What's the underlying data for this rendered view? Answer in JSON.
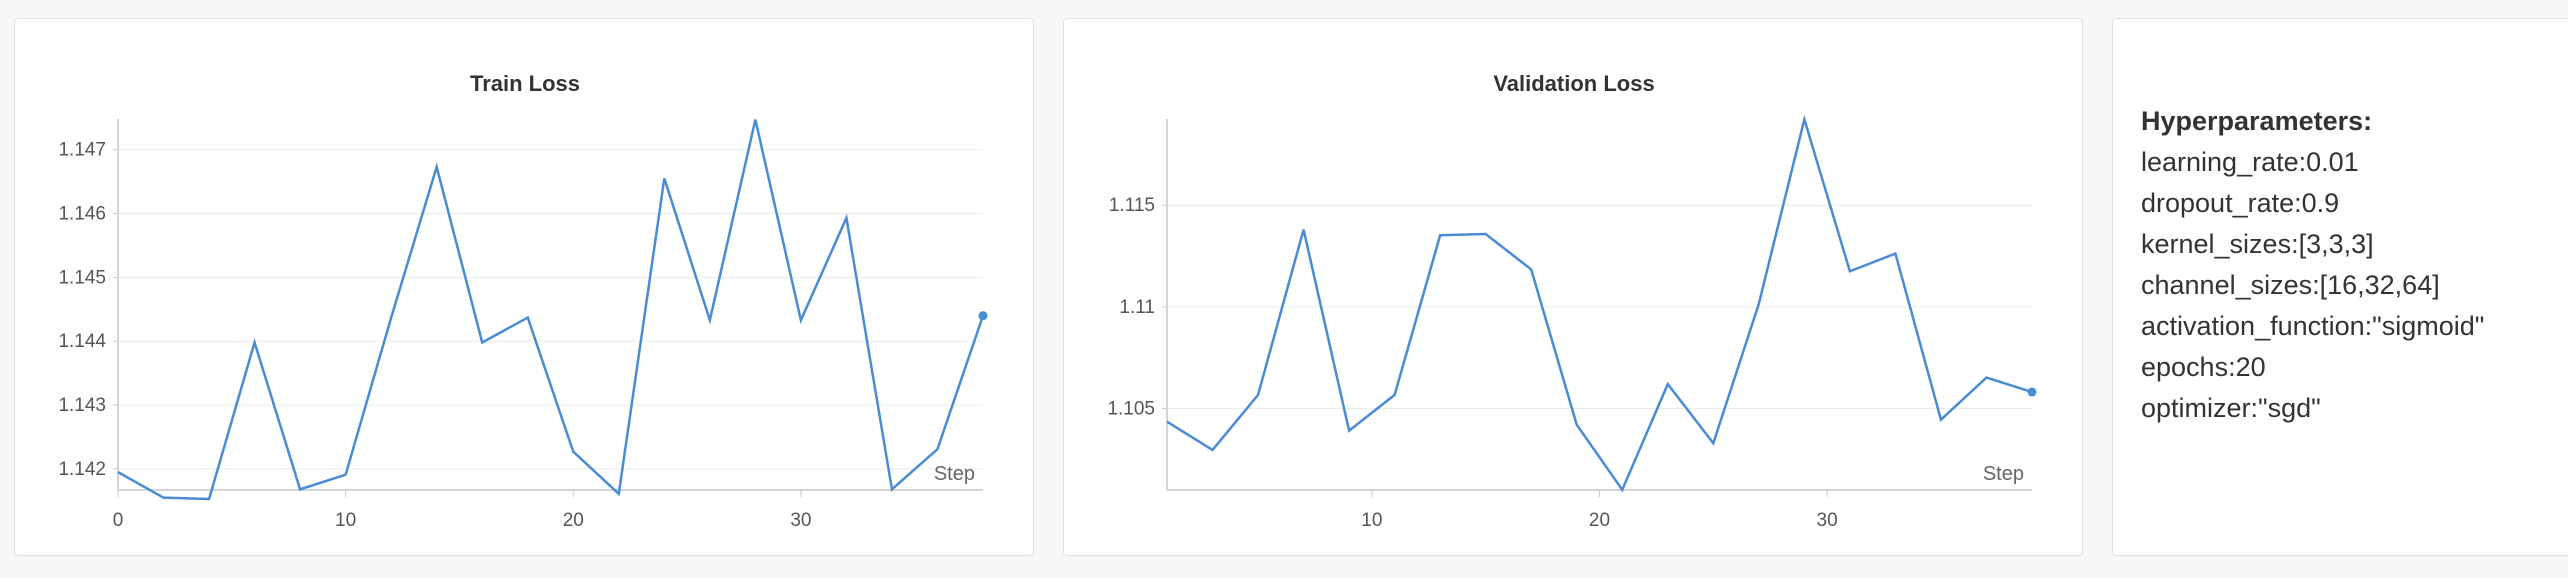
{
  "chart_data": [
    {
      "type": "line",
      "title": "Train Loss",
      "xlabel": "Step",
      "ylabel": "",
      "xlim": [
        0,
        38
      ],
      "ylim": [
        1.14167,
        1.14748
      ],
      "xticks": [
        0,
        10,
        20,
        30
      ],
      "xtick_labels": [
        "0",
        "10",
        "20",
        "30"
      ],
      "yticks": [
        1.142,
        1.143,
        1.144,
        1.145,
        1.146,
        1.147
      ],
      "ytick_labels": [
        "1.142",
        "1.143",
        "1.144",
        "1.145",
        "1.146",
        "1.147"
      ],
      "grid": true,
      "line_color": "#4a8cd4",
      "series": [
        {
          "x": [
            0,
            2,
            4,
            6,
            8,
            10,
            12,
            14,
            16,
            18,
            20,
            22,
            24,
            26,
            28,
            30,
            32,
            34,
            36,
            38
          ],
          "y": [
            1.14195,
            1.14155,
            1.14153,
            1.14398,
            1.14168,
            1.14191,
            1.14437,
            1.14673,
            1.14398,
            1.14437,
            1.14227,
            1.14161,
            1.14655,
            1.14433,
            1.14747,
            1.14433,
            1.14593,
            1.14168,
            1.14231,
            1.1444
          ]
        }
      ]
    },
    {
      "type": "line",
      "title": "Validation Loss",
      "xlabel": "Step",
      "ylabel": "",
      "xlim": [
        1,
        39
      ],
      "ylim": [
        1.10099,
        1.11924
      ],
      "xticks": [
        10,
        20,
        30
      ],
      "xtick_labels": [
        "10",
        "20",
        "30"
      ],
      "yticks": [
        1.105,
        1.11,
        1.115
      ],
      "ytick_labels": [
        "1.105",
        "1.11",
        "1.115"
      ],
      "grid": true,
      "line_color": "#4a8cd4",
      "series": [
        {
          "x": [
            1,
            3,
            5,
            7,
            9,
            11,
            13,
            15,
            17,
            19,
            21,
            23,
            25,
            27,
            29,
            31,
            33,
            35,
            37,
            39
          ],
          "y": [
            1.10435,
            1.10296,
            1.10567,
            1.1138,
            1.10391,
            1.10567,
            1.11352,
            1.11358,
            1.11184,
            1.1042,
            1.101,
            1.1062,
            1.10329,
            1.11015,
            1.11922,
            1.11175,
            1.11262,
            1.10445,
            1.10652,
            1.10581
          ]
        }
      ]
    }
  ],
  "hyperparameters": {
    "title": "Hyperparameters:",
    "items": [
      "learning_rate:0.01",
      "dropout_rate:0.9",
      "kernel_sizes:[3,3,3]",
      "channel_sizes:[16,32,64]",
      "activation_function:\"sigmoid\"",
      "epochs:20",
      "optimizer:\"sgd\""
    ]
  }
}
